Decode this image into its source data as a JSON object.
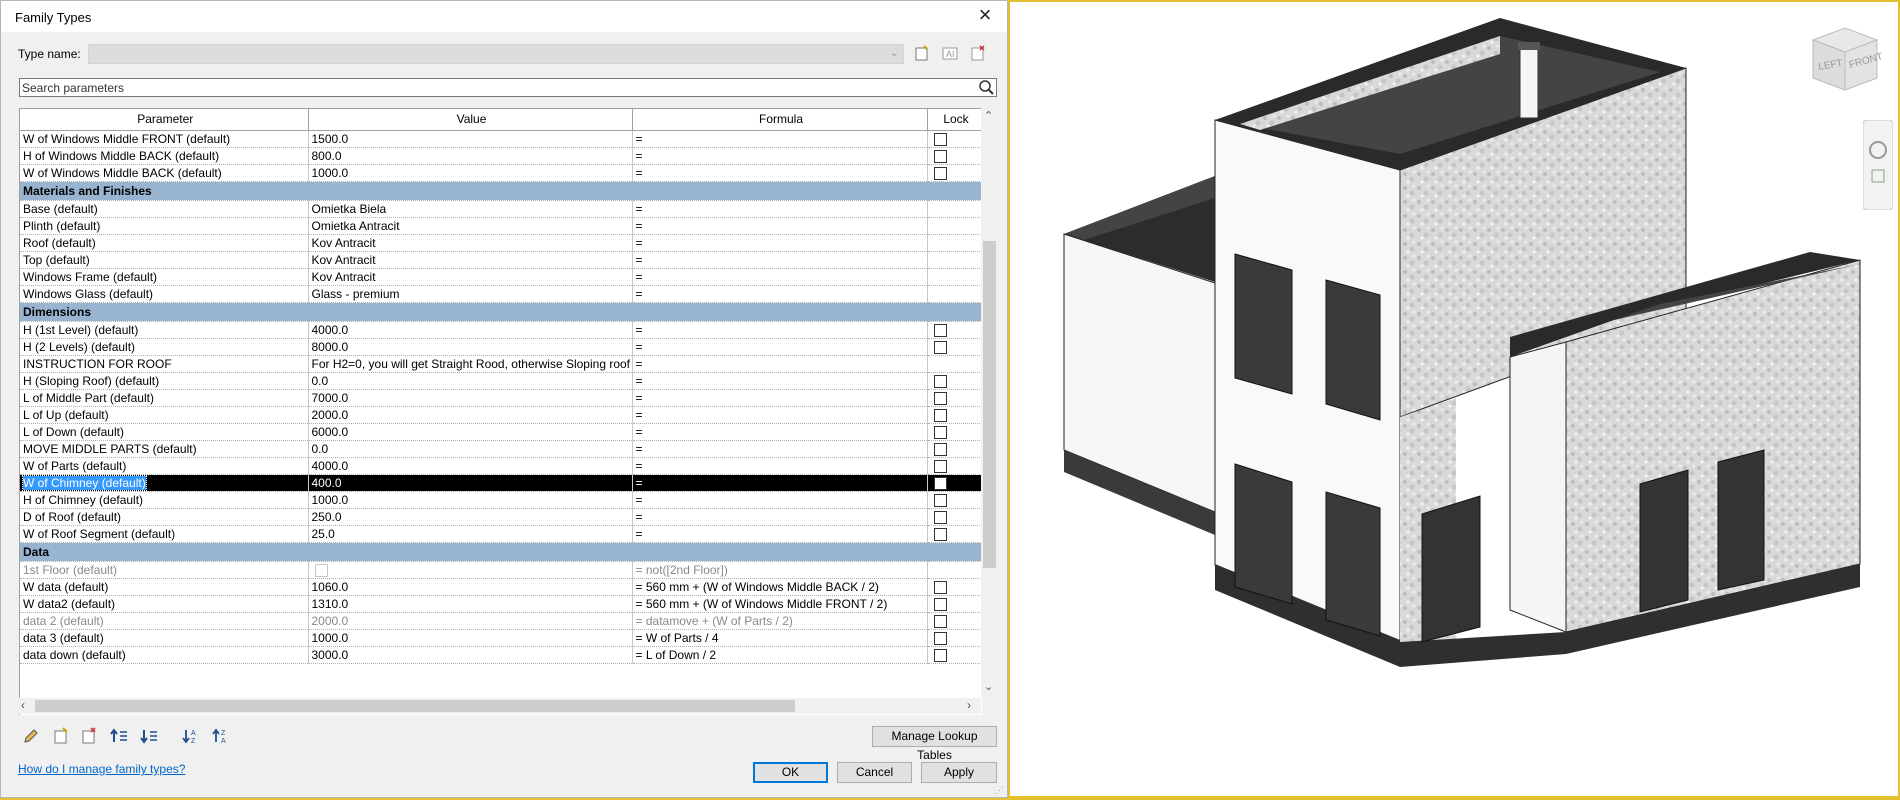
{
  "dialog": {
    "title": "Family Types",
    "type_name_label": "Type name:",
    "type_name_value": "",
    "search_placeholder": "Search parameters",
    "columns": [
      "Parameter",
      "Value",
      "Formula",
      "Lock"
    ],
    "groups": [
      {
        "name": "",
        "rows": [
          {
            "param": "W of Windows Middle FRONT (default)",
            "value": "1500.0",
            "formula": "=",
            "lock": "unchecked"
          },
          {
            "param": "H of Windows Middle BACK (default)",
            "value": "800.0",
            "formula": "=",
            "lock": "unchecked"
          },
          {
            "param": "W of Windows Middle BACK (default)",
            "value": "1000.0",
            "formula": "=",
            "lock": "unchecked"
          }
        ]
      },
      {
        "name": "Materials and Finishes",
        "rows": [
          {
            "param": "Base (default)",
            "value": "Omietka Biela",
            "formula": "=",
            "lock": "none"
          },
          {
            "param": "Plinth (default)",
            "value": "Omietka Antracit",
            "formula": "=",
            "lock": "none"
          },
          {
            "param": "Roof (default)",
            "value": "Kov Antracit",
            "formula": "=",
            "lock": "none"
          },
          {
            "param": "Top (default)",
            "value": "Kov Antracit",
            "formula": "=",
            "lock": "none"
          },
          {
            "param": "Windows Frame (default)",
            "value": "Kov Antracit",
            "formula": "=",
            "lock": "none"
          },
          {
            "param": "Windows Glass (default)",
            "value": "Glass - premium",
            "formula": "=",
            "lock": "none"
          }
        ]
      },
      {
        "name": "Dimensions",
        "rows": [
          {
            "param": "H (1st Level) (default)",
            "value": "4000.0",
            "formula": "=",
            "lock": "unchecked"
          },
          {
            "param": "H (2 Levels) (default)",
            "value": "8000.0",
            "formula": "=",
            "lock": "unchecked"
          },
          {
            "param": "INSTRUCTION FOR ROOF",
            "value": "For H2=0, you will get Straight Rood, otherwise Sloping roof",
            "formula": "=",
            "lock": "none"
          },
          {
            "param": "H (Sloping Roof) (default)",
            "value": "0.0",
            "formula": "=",
            "lock": "unchecked"
          },
          {
            "param": "L of Middle Part (default)",
            "value": "7000.0",
            "formula": "=",
            "lock": "unchecked"
          },
          {
            "param": "L of Up (default)",
            "value": "2000.0",
            "formula": "=",
            "lock": "unchecked"
          },
          {
            "param": "L of Down (default)",
            "value": "6000.0",
            "formula": "=",
            "lock": "unchecked"
          },
          {
            "param": "MOVE MIDDLE PARTS (default)",
            "value": "0.0",
            "formula": "=",
            "lock": "unchecked"
          },
          {
            "param": "W of Parts (default)",
            "value": "4000.0",
            "formula": "=",
            "lock": "unchecked"
          },
          {
            "param": "W of Chimney (default)",
            "value": "400.0",
            "formula": "=",
            "lock": "unchecked",
            "selected": true
          },
          {
            "param": "H of Chimney (default)",
            "value": "1000.0",
            "formula": "=",
            "lock": "unchecked"
          },
          {
            "param": "D of Roof (default)",
            "value": "250.0",
            "formula": "=",
            "lock": "unchecked"
          },
          {
            "param": "W of Roof Segment (default)",
            "value": "25.0",
            "formula": "=",
            "lock": "unchecked"
          }
        ]
      },
      {
        "name": "Data",
        "rows": [
          {
            "param": "1st Floor (default)",
            "value": "",
            "value_checkbox": true,
            "formula": "= not([2nd Floor])",
            "lock": "none",
            "disabled": true
          },
          {
            "param": "W data (default)",
            "value": "1060.0",
            "formula": "= 560 mm + (W of Windows Middle BACK / 2)",
            "lock": "unchecked"
          },
          {
            "param": "W data2 (default)",
            "value": "1310.0",
            "formula": "= 560 mm + (W of Windows Middle FRONT / 2)",
            "lock": "unchecked"
          },
          {
            "param": "data 2 (default)",
            "value": "2000.0",
            "formula": "= datamove + (W of Parts / 2)",
            "lock": "unchecked",
            "disabled": true
          },
          {
            "param": "data 3 (default)",
            "value": "1000.0",
            "formula": "= W of Parts / 4",
            "lock": "unchecked"
          },
          {
            "param": "data down (default)",
            "value": "3000.0",
            "formula": "= L of Down / 2",
            "lock": "unchecked"
          }
        ]
      }
    ],
    "manage_lookup_label": "Manage Lookup Tables",
    "help_link": "How do I manage family types?",
    "ok_label": "OK",
    "cancel_label": "Cancel",
    "apply_label": "Apply"
  },
  "viewcube": {
    "left_label": "LEFT",
    "front_label": "FRONT"
  },
  "colors": {
    "group_header": "#99b4d1",
    "selection_row": "#000000",
    "selection_highlight": "#3399ff",
    "link": "#0066cc",
    "window_border": "#e5c02e"
  }
}
